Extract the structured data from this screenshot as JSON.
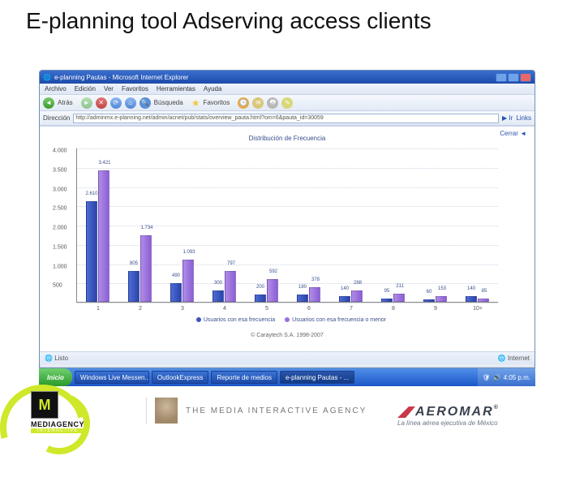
{
  "slide_title": "E-planning tool Adserving access clients",
  "ie": {
    "title": "e-planning Pautas - Microsoft Internet Explorer",
    "menu": [
      "Archivo",
      "Edición",
      "Ver",
      "Favoritos",
      "Herramientas",
      "Ayuda"
    ],
    "toolbar": {
      "back": "Atrás",
      "search": "Búsqueda",
      "favorites": "Favoritos"
    },
    "addr_label": "Dirección",
    "address": "http://adminmx.e-planning.net/admin/acnet/pub/stats/overview_pauta.html?om=6&pauta_id=30059",
    "go": "Ir",
    "links": "Links",
    "status_left": "Listo",
    "status_right": "Internet"
  },
  "page": {
    "close": "Cerrar",
    "legend_a": "Usuarios con esa frecuencia",
    "legend_b": "Usuarios con esa frecuencia o menor",
    "copyright": "© Caraytech S.A. 1998-2007"
  },
  "taskbar": {
    "start": "Inicio",
    "tasks": [
      "",
      "Windows Live Messen...",
      "OutlookExpress",
      "Reporte de medios",
      "e-planning Pautas - ..."
    ],
    "tray_time": "4:05 p.m."
  },
  "footer": {
    "mediagency": "MEDIAGENCY",
    "mediagency_sub": "INTERACTIVE",
    "tmia": "THE MEDIA INTERACTIVE AGENCY",
    "aeromar": "AEROMAR",
    "aeromar_sub": "La línea aérea ejecutiva de México",
    "reg": "®"
  },
  "chart_data": {
    "type": "bar",
    "title": "Distribución de Frecuencia",
    "xlabel": "",
    "ylabel": "",
    "ylim": [
      0,
      4000
    ],
    "yticks": [
      0,
      500,
      1000,
      1500,
      2000,
      2500,
      3000,
      3500,
      4000
    ],
    "categories": [
      "1",
      "2",
      "3",
      "4",
      "5",
      "6",
      "7",
      "8",
      "9",
      "10+"
    ],
    "series": [
      {
        "name": "Usuarios con esa frecuencia",
        "color": "#3a55c0",
        "values": [
          2610,
          805,
          490,
          300,
          200,
          180,
          140,
          95,
          60,
          140
        ]
      },
      {
        "name": "Usuarios con esa frecuencia o menor",
        "color": "#9a70de",
        "values": [
          3421,
          1734,
          1093,
          797,
          592,
          378,
          288,
          211,
          153,
          85
        ]
      }
    ],
    "y_label_format": "n.nnn"
  }
}
